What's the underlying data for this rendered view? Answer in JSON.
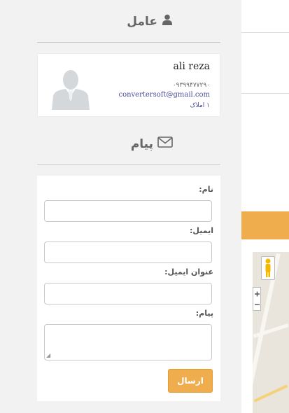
{
  "agent_section": {
    "title": "عامل",
    "icon": "user-icon"
  },
  "agent": {
    "name": "ali reza",
    "phone": "۰۹۳۹۹۴۷۷۲۹۰",
    "email": "convertersoft@gmail.com",
    "properties": "۱ املاک",
    "avatar_icon": "person-silhouette-icon"
  },
  "message_section": {
    "title": "پیام",
    "icon": "envelope-icon"
  },
  "form": {
    "name_label": "نام:",
    "email_label": "ایمیل:",
    "subject_label": "عنوان ایمیل:",
    "message_label": "پیام:",
    "name_value": "",
    "email_value": "",
    "subject_value": "",
    "message_value": "",
    "send_label": "ارسال"
  },
  "colors": {
    "accent": "#f0ad4e",
    "link": "#4a4a9a",
    "heading": "#666666"
  }
}
